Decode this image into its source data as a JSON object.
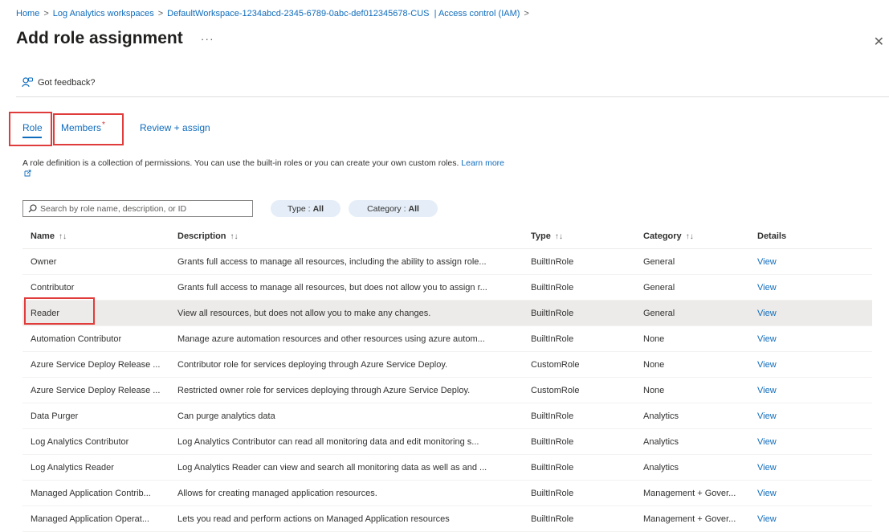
{
  "breadcrumb": [
    "Home",
    "Log Analytics workspaces",
    "DefaultWorkspace-1234abcd-2345-6789-0abc-def012345678-CUS",
    "| Access control (IAM)"
  ],
  "page": {
    "title": "Add role assignment",
    "more": "···",
    "close": "✕"
  },
  "feedback": {
    "label": "Got feedback?"
  },
  "tabs": {
    "role": "Role",
    "members": "Members",
    "members_required": "*",
    "review": "Review + assign"
  },
  "description": {
    "text": "A role definition is a collection of permissions. You can use the built-in roles or you can create your own custom roles.",
    "learn_more": "Learn more"
  },
  "search": {
    "placeholder": "Search by role name, description, or ID",
    "value": ""
  },
  "filters": {
    "type": {
      "label": "Type :",
      "value": "All"
    },
    "category": {
      "label": "Category :",
      "value": "All"
    }
  },
  "columns": {
    "name": "Name",
    "description": "Description",
    "type": "Type",
    "category": "Category",
    "details": "Details",
    "sort_glyph": "↑↓"
  },
  "rows": [
    {
      "name": "Owner",
      "description": "Grants full access to manage all resources, including the ability to assign role...",
      "type": "BuiltInRole",
      "category": "General",
      "details": "View"
    },
    {
      "name": "Contributor",
      "description": "Grants full access to manage all resources, but does not allow you to assign r...",
      "type": "BuiltInRole",
      "category": "General",
      "details": "View"
    },
    {
      "name": "Reader",
      "description": "View all resources, but does not allow you to make any changes.",
      "type": "BuiltInRole",
      "category": "General",
      "details": "View"
    },
    {
      "name": "Automation Contributor",
      "description": "Manage azure automation resources and other resources using azure autom...",
      "type": "BuiltInRole",
      "category": "None",
      "details": "View"
    },
    {
      "name": "Azure Service Deploy Release ...",
      "description": "Contributor role for services deploying through Azure Service Deploy.",
      "type": "CustomRole",
      "category": "None",
      "details": "View"
    },
    {
      "name": "Azure Service Deploy Release ...",
      "description": "Restricted owner role for services deploying through Azure Service Deploy.",
      "type": "CustomRole",
      "category": "None",
      "details": "View"
    },
    {
      "name": "Data Purger",
      "description": "Can purge analytics data",
      "type": "BuiltInRole",
      "category": "Analytics",
      "details": "View"
    },
    {
      "name": "Log Analytics Contributor",
      "description": "Log Analytics Contributor can read all monitoring data and edit monitoring s...",
      "type": "BuiltInRole",
      "category": "Analytics",
      "details": "View"
    },
    {
      "name": "Log Analytics Reader",
      "description": "Log Analytics Reader can view and search all monitoring data as well as and ...",
      "type": "BuiltInRole",
      "category": "Analytics",
      "details": "View"
    },
    {
      "name": "Managed Application Contrib...",
      "description": "Allows for creating managed application resources.",
      "type": "BuiltInRole",
      "category": "Management + Gover...",
      "details": "View"
    },
    {
      "name": "Managed Application Operat...",
      "description": "Lets you read and perform actions on Managed Application resources",
      "type": "BuiltInRole",
      "category": "Management + Gover...",
      "details": "View"
    }
  ],
  "colors": {
    "accent": "#0f6cbd",
    "highlight": "#e03c3c",
    "selected_row": "#edebe9",
    "pill": "#e5eef8"
  },
  "icons": [
    "feedback-icon",
    "search-icon",
    "external-link-icon",
    "sort-icon",
    "close-icon"
  ]
}
